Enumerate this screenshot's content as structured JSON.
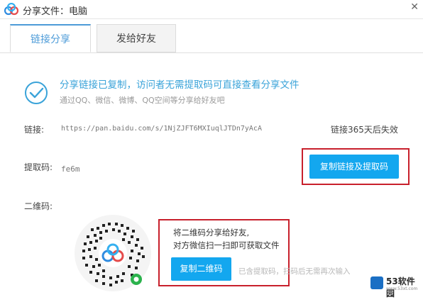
{
  "window": {
    "title": "分享文件：电脑",
    "close_glyph": "✕",
    "app_icon": "baidu-netdisk-cloud-icon"
  },
  "tabs": [
    {
      "label": "链接分享",
      "active": true
    },
    {
      "label": "发给好友",
      "active": false
    }
  ],
  "status": {
    "headline": "分享链接已复制，访问者无需提取码可直接查看分享文件",
    "subline": "通过QQ、微信、微博、QQ空间等分享给好友吧",
    "icon": "check-circle-icon"
  },
  "link": {
    "label": "链接:",
    "url": "https://pan.baidu.com/s/1NjZJFT6MXIuqlJTDn7yAcA",
    "expire": "链接365天后失效"
  },
  "code": {
    "label": "提取码:",
    "value": "fe6m"
  },
  "copy_link_button": "复制链接及提取码",
  "qrcode": {
    "label": "二维码:",
    "line1": "将二维码分享给好友,",
    "line2": "对方微信扫一扫即可获取文件",
    "copy_button": "复制二维码",
    "hint": "已含提取码，扫码后无需再次输入"
  },
  "watermark": {
    "text": "53软件园",
    "sub": "www.53xt.com"
  },
  "colors": {
    "accent": "#13a7ef",
    "highlight_box": "#c8202c",
    "headline": "#3aa3d9"
  }
}
